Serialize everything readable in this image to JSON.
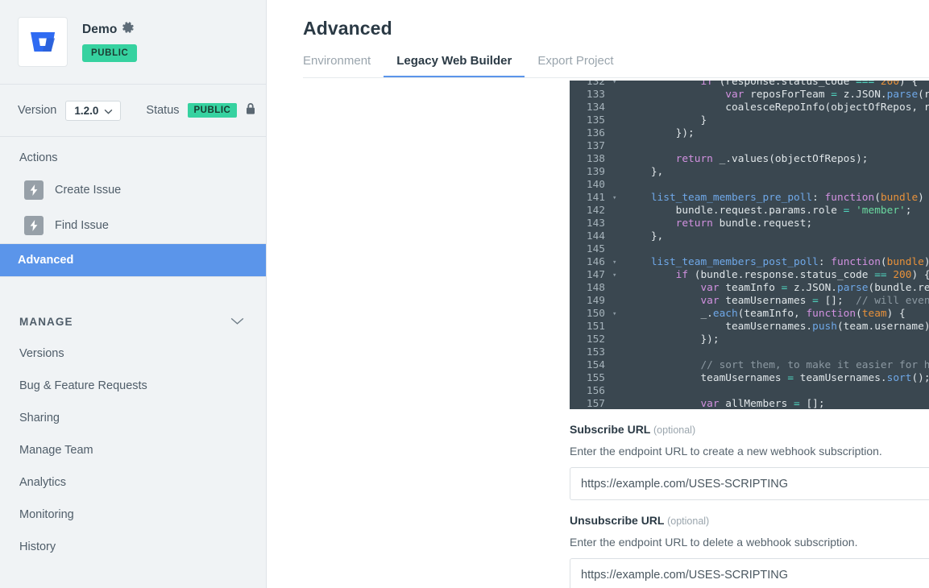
{
  "sidebar": {
    "app": {
      "logo_icon": "bitbucket-logo",
      "title": "Demo",
      "settings_icon": "gear-icon",
      "visibility_badge": "PUBLIC"
    },
    "version_bar": {
      "version_label": "Version",
      "version_value": "1.2.0",
      "status_label": "Status",
      "status_value": "PUBLIC",
      "lock_icon": "lock-icon"
    },
    "actions_heading": "Actions",
    "actions": [
      {
        "label": "Create Issue",
        "icon": "lightning-bolt-icon"
      },
      {
        "label": "Find Issue",
        "icon": "lightning-bolt-icon"
      }
    ],
    "advanced_item": "Advanced",
    "manage_heading": "MANAGE",
    "manage_chevron_icon": "chevron-down-icon",
    "manage_items": [
      "Versions",
      "Bug & Feature Requests",
      "Sharing",
      "Manage Team",
      "Analytics",
      "Monitoring",
      "History"
    ]
  },
  "main": {
    "page_title": "Advanced",
    "tabs": [
      {
        "label": "Environment",
        "active": false
      },
      {
        "label": "Legacy Web Builder",
        "active": true
      },
      {
        "label": "Export Project",
        "active": false
      }
    ],
    "fields": [
      {
        "label": "Subscribe URL",
        "optional": "(optional)",
        "help": "Enter the endpoint URL to create a new webhook subscription.",
        "value": "https://example.com/USES-SCRIPTING"
      },
      {
        "label": "Unsubscribe URL",
        "optional": "(optional)",
        "help": "Enter the endpoint URL to delete a webhook subscription.",
        "value": "https://example.com/USES-SCRIPTING"
      }
    ]
  },
  "code_editor": {
    "first_line": 132,
    "lines": [
      {
        "n": 132,
        "fold": true,
        "tokens": [
          [
            "plain",
            "            "
          ],
          [
            "kw",
            "if"
          ],
          [
            "plain",
            " (response.status_code "
          ],
          [
            "op",
            "==="
          ],
          [
            "plain",
            " "
          ],
          [
            "num",
            "200"
          ],
          [
            "plain",
            ") {"
          ]
        ]
      },
      {
        "n": 133,
        "fold": false,
        "tokens": [
          [
            "plain",
            "                "
          ],
          [
            "kw",
            "var"
          ],
          [
            "plain",
            " reposForTeam "
          ],
          [
            "op",
            "="
          ],
          [
            "plain",
            " z.JSON."
          ],
          [
            "fn",
            "parse"
          ],
          [
            "plain",
            "(response.content).values;"
          ]
        ]
      },
      {
        "n": 134,
        "fold": false,
        "tokens": [
          [
            "plain",
            "                coalesceRepoInfo(objectOfRepos, reposForTeam);"
          ]
        ]
      },
      {
        "n": 135,
        "fold": false,
        "tokens": [
          [
            "plain",
            "            }"
          ]
        ]
      },
      {
        "n": 136,
        "fold": false,
        "tokens": [
          [
            "plain",
            "        });"
          ]
        ]
      },
      {
        "n": 137,
        "fold": false,
        "tokens": [
          [
            "plain",
            ""
          ]
        ]
      },
      {
        "n": 138,
        "fold": false,
        "tokens": [
          [
            "plain",
            "        "
          ],
          [
            "kw",
            "return"
          ],
          [
            "plain",
            " _.values(objectOfRepos);"
          ]
        ]
      },
      {
        "n": 139,
        "fold": false,
        "tokens": [
          [
            "plain",
            "    },"
          ]
        ]
      },
      {
        "n": 140,
        "fold": false,
        "tokens": [
          [
            "plain",
            ""
          ]
        ]
      },
      {
        "n": 141,
        "fold": true,
        "tokens": [
          [
            "plain",
            "    "
          ],
          [
            "fn",
            "list_team_members_pre_poll"
          ],
          [
            "plain",
            ": "
          ],
          [
            "kw",
            "function"
          ],
          [
            "plain",
            "("
          ],
          [
            "param",
            "bundle"
          ],
          [
            "plain",
            ") {"
          ]
        ]
      },
      {
        "n": 142,
        "fold": false,
        "tokens": [
          [
            "plain",
            "        bundle.request.params.role "
          ],
          [
            "op",
            "="
          ],
          [
            "plain",
            " "
          ],
          [
            "str",
            "'member'"
          ],
          [
            "plain",
            ";"
          ]
        ]
      },
      {
        "n": 143,
        "fold": false,
        "tokens": [
          [
            "plain",
            "        "
          ],
          [
            "kw",
            "return"
          ],
          [
            "plain",
            " bundle.request;"
          ]
        ]
      },
      {
        "n": 144,
        "fold": false,
        "tokens": [
          [
            "plain",
            "    },"
          ]
        ]
      },
      {
        "n": 145,
        "fold": false,
        "tokens": [
          [
            "plain",
            ""
          ]
        ]
      },
      {
        "n": 146,
        "fold": true,
        "tokens": [
          [
            "plain",
            "    "
          ],
          [
            "fn",
            "list_team_members_post_poll"
          ],
          [
            "plain",
            ": "
          ],
          [
            "kw",
            "function"
          ],
          [
            "plain",
            "("
          ],
          [
            "param",
            "bundle"
          ],
          [
            "plain",
            ") {"
          ]
        ]
      },
      {
        "n": 147,
        "fold": true,
        "tokens": [
          [
            "plain",
            "        "
          ],
          [
            "kw",
            "if"
          ],
          [
            "plain",
            " (bundle.response.status_code "
          ],
          [
            "op",
            "=="
          ],
          [
            "plain",
            " "
          ],
          [
            "num",
            "200"
          ],
          [
            "plain",
            ") {"
          ]
        ]
      },
      {
        "n": 148,
        "fold": false,
        "tokens": [
          [
            "plain",
            "            "
          ],
          [
            "kw",
            "var"
          ],
          [
            "plain",
            " teamInfo "
          ],
          [
            "op",
            "="
          ],
          [
            "plain",
            " z.JSON."
          ],
          [
            "fn",
            "parse"
          ],
          [
            "plain",
            "(bundle.response.content).values;"
          ]
        ]
      },
      {
        "n": 149,
        "fold": false,
        "tokens": [
          [
            "plain",
            "            "
          ],
          [
            "kw",
            "var"
          ],
          [
            "plain",
            " teamUsernames "
          ],
          [
            "op",
            "="
          ],
          [
            "plain",
            " [];  "
          ],
          [
            "com",
            "// will eventually contain a bunch of St"
          ]
        ]
      },
      {
        "n": 150,
        "fold": true,
        "tokens": [
          [
            "plain",
            "            _."
          ],
          [
            "fn",
            "each"
          ],
          [
            "plain",
            "(teamInfo, "
          ],
          [
            "kw",
            "function"
          ],
          [
            "plain",
            "("
          ],
          [
            "param",
            "team"
          ],
          [
            "plain",
            ") {"
          ]
        ]
      },
      {
        "n": 151,
        "fold": false,
        "tokens": [
          [
            "plain",
            "                teamUsernames."
          ],
          [
            "fn",
            "push"
          ],
          [
            "plain",
            "(team.username);"
          ]
        ]
      },
      {
        "n": 152,
        "fold": false,
        "tokens": [
          [
            "plain",
            "            });"
          ]
        ]
      },
      {
        "n": 153,
        "fold": false,
        "tokens": [
          [
            "plain",
            ""
          ]
        ]
      },
      {
        "n": 154,
        "fold": false,
        "tokens": [
          [
            "plain",
            "            "
          ],
          [
            "com",
            "// sort them, to make it easier for humans to comprehend the list"
          ]
        ]
      },
      {
        "n": 155,
        "fold": false,
        "tokens": [
          [
            "plain",
            "            teamUsernames "
          ],
          [
            "op",
            "="
          ],
          [
            "plain",
            " teamUsernames."
          ],
          [
            "fn",
            "sort"
          ],
          [
            "plain",
            "();"
          ]
        ]
      },
      {
        "n": 156,
        "fold": false,
        "tokens": [
          [
            "plain",
            ""
          ]
        ]
      },
      {
        "n": 157,
        "fold": false,
        "tokens": [
          [
            "plain",
            "            "
          ],
          [
            "kw",
            "var"
          ],
          [
            "plain",
            " allMembers "
          ],
          [
            "op",
            "="
          ],
          [
            "plain",
            " [];"
          ]
        ]
      }
    ]
  },
  "colors": {
    "accent": "#5b95ea",
    "badge_green": "#36d2a0",
    "sidebar_bg": "#f0f3f5",
    "code_bg": "#3a4750"
  }
}
